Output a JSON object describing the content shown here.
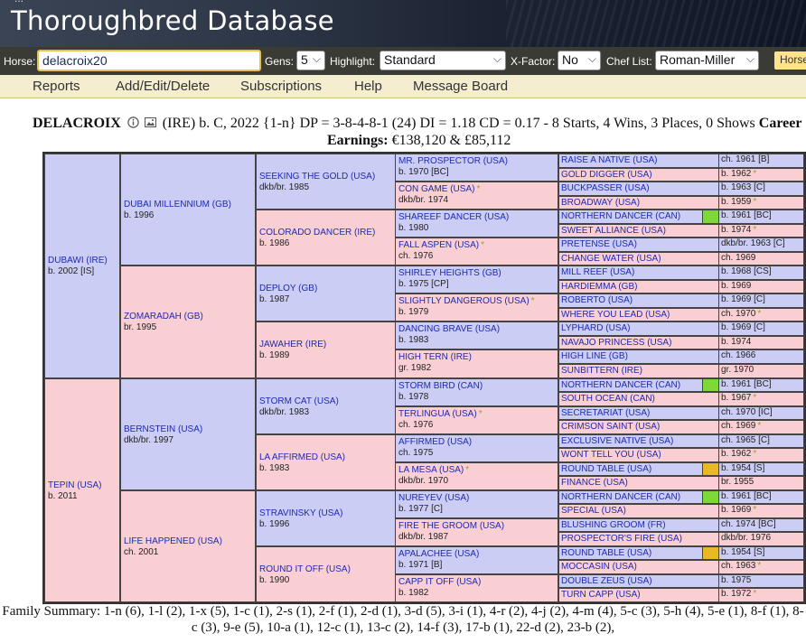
{
  "banner": {
    "subtitle": "...",
    "title": "Thoroughbred Database"
  },
  "controls": {
    "horse_label": "Horse:",
    "horse_value": "delacroix20",
    "gens_label": "Gens:",
    "gens_value": "5",
    "highlight_label": "Highlight:",
    "highlight_value": "Standard",
    "xfactor_label": "X-Factor:",
    "xfactor_value": "No",
    "chef_label": "Chef List:",
    "chef_value": "Roman-Miller",
    "horse_button": "Horse"
  },
  "menu": [
    "Reports",
    "Add/Edit/Delete",
    "Subscriptions",
    "Help",
    "Message Board"
  ],
  "header": {
    "name": "DELACROIX",
    "line1": "(IRE) b. C, 2022 {1-n} DP = 3-8-4-8-1 (24) DI = 1.18   CD = 0.17 - 8 Starts, 4 Wins, 3 Places, 0 Shows",
    "career": "Career",
    "earnings_label": "Earnings:",
    "earnings_value": "€138,120 & £85,112"
  },
  "pedigree": {
    "g1": [
      {
        "name": "DUBAWI (IRE)",
        "info": "b. 2002 [IS]"
      },
      {
        "name": "TEPIN (USA)",
        "info": "b. 2011"
      }
    ],
    "g2": [
      {
        "name": "DUBAI MILLENNIUM (GB)",
        "info": "b. 1996"
      },
      {
        "name": "ZOMARADAH (GB)",
        "info": "br. 1995"
      },
      {
        "name": "BERNSTEIN (USA)",
        "info": "dkb/br. 1997"
      },
      {
        "name": "LIFE HAPPENED (USA)",
        "info": "ch. 2001"
      }
    ],
    "g3": [
      {
        "name": "SEEKING THE GOLD (USA)",
        "info": "dkb/br. 1985"
      },
      {
        "name": "COLORADO DANCER (IRE)",
        "info": "b. 1986"
      },
      {
        "name": "DEPLOY (GB)",
        "info": "b. 1987"
      },
      {
        "name": "JAWAHER (IRE)",
        "info": "b. 1989"
      },
      {
        "name": "STORM CAT (USA)",
        "info": "dkb/br. 1983"
      },
      {
        "name": "LA AFFIRMED (USA)",
        "info": "b. 1983"
      },
      {
        "name": "STRAVINSKY (USA)",
        "info": "b. 1996"
      },
      {
        "name": "ROUND IT OFF (USA)",
        "info": "b. 1990"
      }
    ],
    "g4": [
      {
        "name": "MR. PROSPECTOR (USA)",
        "info": "b. 1970 [BC]"
      },
      {
        "name": "CON GAME (USA)",
        "star": "*",
        "info": "dkb/br. 1974"
      },
      {
        "name": "SHAREEF DANCER (USA)",
        "info": "b. 1980"
      },
      {
        "name": "FALL ASPEN (USA)",
        "star": "*",
        "info": "ch. 1976"
      },
      {
        "name": "SHIRLEY HEIGHTS (GB)",
        "info": "b. 1975 [CP]"
      },
      {
        "name": "SLIGHTLY DANGEROUS (USA)",
        "star": "*",
        "info": "b. 1979"
      },
      {
        "name": "DANCING BRAVE (USA)",
        "info": "b. 1983"
      },
      {
        "name": "HIGH TERN (IRE)",
        "info": "gr. 1982"
      },
      {
        "name": "STORM BIRD (CAN)",
        "info": "b. 1978"
      },
      {
        "name": "TERLINGUA (USA)",
        "star": "*",
        "info": "ch. 1976"
      },
      {
        "name": "AFFIRMED (USA)",
        "info": "ch. 1975"
      },
      {
        "name": "LA MESA (USA)",
        "star": "*",
        "info": "dkb/br. 1970"
      },
      {
        "name": "NUREYEV (USA)",
        "info": "b. 1977 [C]"
      },
      {
        "name": "FIRE THE GROOM (USA)",
        "info": "dkb/br. 1987"
      },
      {
        "name": "APALACHEE (USA)",
        "info": "b. 1971 [B]"
      },
      {
        "name": "CAPP IT OFF (USA)",
        "info": "b. 1982"
      }
    ],
    "g5": [
      {
        "name": "RAISE A NATIVE (USA)",
        "info": "ch. 1961 [B]"
      },
      {
        "name": "GOLD DIGGER (USA)",
        "info": "b. 1962",
        "star": "*"
      },
      {
        "name": "BUCKPASSER (USA)",
        "info": "b. 1963 [C]"
      },
      {
        "name": "BROADWAY (USA)",
        "info": "b. 1959",
        "star": "*"
      },
      {
        "name": "NORTHERN DANCER (CAN)",
        "info": "b. 1961 [BC]",
        "flag": "#7fd83a"
      },
      {
        "name": "SWEET ALLIANCE (USA)",
        "info": "b. 1974",
        "star": "*"
      },
      {
        "name": "PRETENSE (USA)",
        "info": "dkb/br. 1963 [C]"
      },
      {
        "name": "CHANGE WATER (USA)",
        "info": "ch. 1969"
      },
      {
        "name": "MILL REEF (USA)",
        "info": "b. 1968 [CS]"
      },
      {
        "name": "HARDIEMMA (GB)",
        "info": "b. 1969"
      },
      {
        "name": "ROBERTO (USA)",
        "info": "b. 1969 [C]"
      },
      {
        "name": "WHERE YOU LEAD (USA)",
        "info": "ch. 1970",
        "star": "*"
      },
      {
        "name": "LYPHARD (USA)",
        "info": "b. 1969 [C]"
      },
      {
        "name": "NAVAJO PRINCESS (USA)",
        "info": "b. 1974"
      },
      {
        "name": "HIGH LINE (GB)",
        "info": "ch. 1966"
      },
      {
        "name": "SUNBITTERN (IRE)",
        "info": "gr. 1970"
      },
      {
        "name": "NORTHERN DANCER (CAN)",
        "info": "b. 1961 [BC]",
        "flag": "#7fd83a"
      },
      {
        "name": "SOUTH OCEAN (CAN)",
        "info": "b. 1967",
        "star": "*"
      },
      {
        "name": "SECRETARIAT (USA)",
        "info": "ch. 1970 [IC]"
      },
      {
        "name": "CRIMSON SAINT (USA)",
        "info": "ch. 1969",
        "star": "*"
      },
      {
        "name": "EXCLUSIVE NATIVE (USA)",
        "info": "ch. 1965 [C]"
      },
      {
        "name": "WONT TELL YOU (USA)",
        "info": "b. 1962",
        "star": "*"
      },
      {
        "name": "ROUND TABLE (USA)",
        "info": "b. 1954 [S]",
        "flag": "#e8b925"
      },
      {
        "name": "FINANCE (USA)",
        "info": "br. 1955"
      },
      {
        "name": "NORTHERN DANCER (CAN)",
        "info": "b. 1961 [BC]",
        "flag": "#7fd83a"
      },
      {
        "name": "SPECIAL (USA)",
        "info": "b. 1969",
        "star": "*"
      },
      {
        "name": "BLUSHING GROOM (FR)",
        "info": "ch. 1974 [BC]"
      },
      {
        "name": "PROSPECTOR'S FIRE (USA)",
        "info": "dkb/br. 1976"
      },
      {
        "name": "ROUND TABLE (USA)",
        "info": "b. 1954 [S]",
        "flag": "#e8b925"
      },
      {
        "name": "MOCCASIN (USA)",
        "info": "ch. 1963",
        "star": "*"
      },
      {
        "name": "DOUBLE ZEUS (USA)",
        "info": "b. 1975"
      },
      {
        "name": "TURN CAPP (USA)",
        "info": "b. 1972",
        "star": "*"
      }
    ]
  },
  "family_summary": "Family Summary: 1-n (6), 1-l (2), 1-x (5), 1-c (1), 2-s (1), 2-f (1), 2-d (1), 3-d (5), 3-i (1), 4-r (2), 4-j (2), 4-m (4), 5-c (3), 5-h (4), 5-e (1), 8-f (1), 8-c (3), 9-e (5), 10-a (1), 12-c (1), 13-c (2), 14-f (3), 17-b (1), 22-d (2), 23-b (2),"
}
